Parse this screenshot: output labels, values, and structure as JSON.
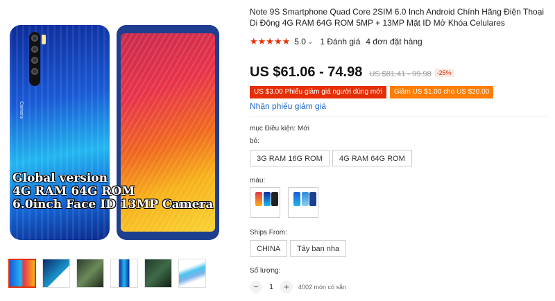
{
  "product": {
    "title": "Note 9S Smartphone Quad Core 2SIM 6.0 Inch Android Chính Hãng Điện Thoại Di Động 4G RAM 64G ROM 5MP + 13MP Mặt ID Mở Khóa Celulares",
    "stars": "★★★★★",
    "rating": "5.0",
    "rating_chevron": "⌄",
    "review_count": "1 Đánh giá",
    "order_count": "4 đơn đặt hàng"
  },
  "image": {
    "promo_line1": "Global version",
    "promo_line2": "4G RAM 64G ROM",
    "promo_line3": "6.0inch Face ID 13MP Camera",
    "back_label": "Camera"
  },
  "thumbnails": [
    {
      "alt": "thumb-1"
    },
    {
      "alt": "thumb-2"
    },
    {
      "alt": "thumb-3"
    },
    {
      "alt": "thumb-4"
    },
    {
      "alt": "thumb-5"
    },
    {
      "alt": "thumb-6"
    }
  ],
  "pricing": {
    "price": "US $61.06 - 74.98",
    "old_price": "US $81.41 - 99.98",
    "discount": "-25%"
  },
  "coupons": {
    "new_user": "US $3.00 Phiếu giảm giá người dùng mới",
    "store": "Giảm US $1.00 cho US $20.00",
    "get_coupon_link": "Nhận phiếu giảm giá"
  },
  "options": {
    "condition_label": "mục Điều kiện: Mới",
    "bundle_label": "bó:",
    "bundle_values": [
      "3G RAM 16G ROM",
      "4G RAM 64G ROM"
    ],
    "color_label": "màu:",
    "ships_from_label": "Ships From:",
    "ships_from_values": [
      "CHINA",
      "Tây ban nha"
    ],
    "quantity_label": "Số lượng:",
    "quantity_value": "1",
    "minus": "−",
    "plus": "+",
    "stock": "4002 món có sẵn"
  },
  "colors": {
    "accent": "#e62e04",
    "orange": "#ff7d00",
    "link": "#1a66c2"
  }
}
